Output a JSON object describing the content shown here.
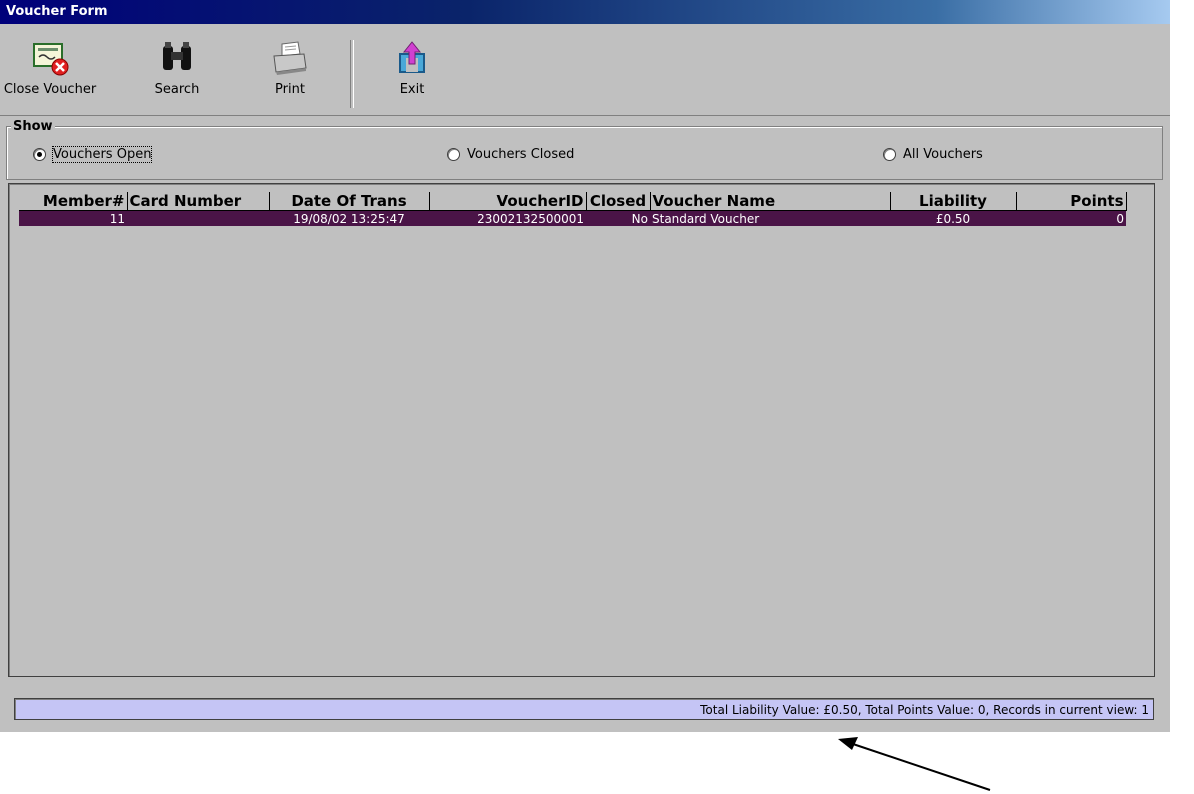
{
  "window": {
    "title": "Voucher Form"
  },
  "toolbar": {
    "close_voucher": "Close Voucher",
    "search": "Search",
    "print": "Print",
    "exit": "Exit"
  },
  "show": {
    "legend": "Show",
    "options": [
      "Vouchers Open",
      "Vouchers Closed",
      "All Vouchers"
    ],
    "selected": "Vouchers Open"
  },
  "table": {
    "columns": [
      "Member#",
      "Card Number",
      "Date Of Trans",
      "VoucherID",
      "Closed",
      "Voucher Name",
      "Liability",
      "Points"
    ],
    "rows": [
      [
        "11",
        "",
        "19/08/02 13:25:47",
        "23002132500001",
        "No",
        "Standard Voucher",
        "£0.50",
        "0"
      ]
    ]
  },
  "status": {
    "text": "Total Liability Value: £0.50,  Total Points Value: 0,  Records in current view: 1"
  },
  "colors": {
    "title_bar": "#0a246a",
    "selected_row": "#4a1447",
    "status_bg": "#c5c5f5",
    "window_bg": "#c0c0c0"
  }
}
